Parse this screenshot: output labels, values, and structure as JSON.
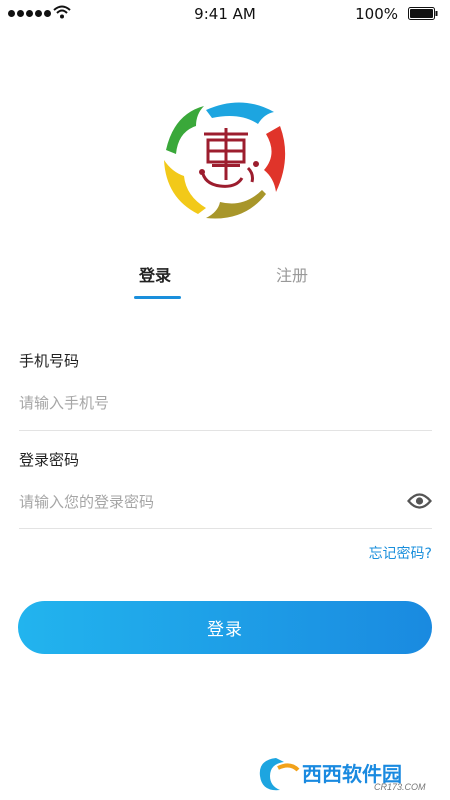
{
  "status_bar": {
    "time": "9:41 AM",
    "battery": "100%"
  },
  "logo": {
    "icon": "hui-logo",
    "colors": [
      "#1da5e0",
      "#e0342a",
      "#a8962a",
      "#f2c919",
      "#3aa83a",
      "#9c1d2e"
    ]
  },
  "tabs": {
    "login": "登录",
    "register": "注册",
    "active": "login"
  },
  "form": {
    "phone_label": "手机号码",
    "phone_placeholder": "请输入手机号",
    "password_label": "登录密码",
    "password_placeholder": "请输入您的登录密码",
    "forgot_password": "忘记密码?"
  },
  "login_button": "登录",
  "watermark": {
    "text": "西西软件园",
    "subtext": "CR173.COM"
  },
  "colors": {
    "accent": "#1a8fdc",
    "button_start": "#22b4ee",
    "button_end": "#1a8ae0"
  }
}
